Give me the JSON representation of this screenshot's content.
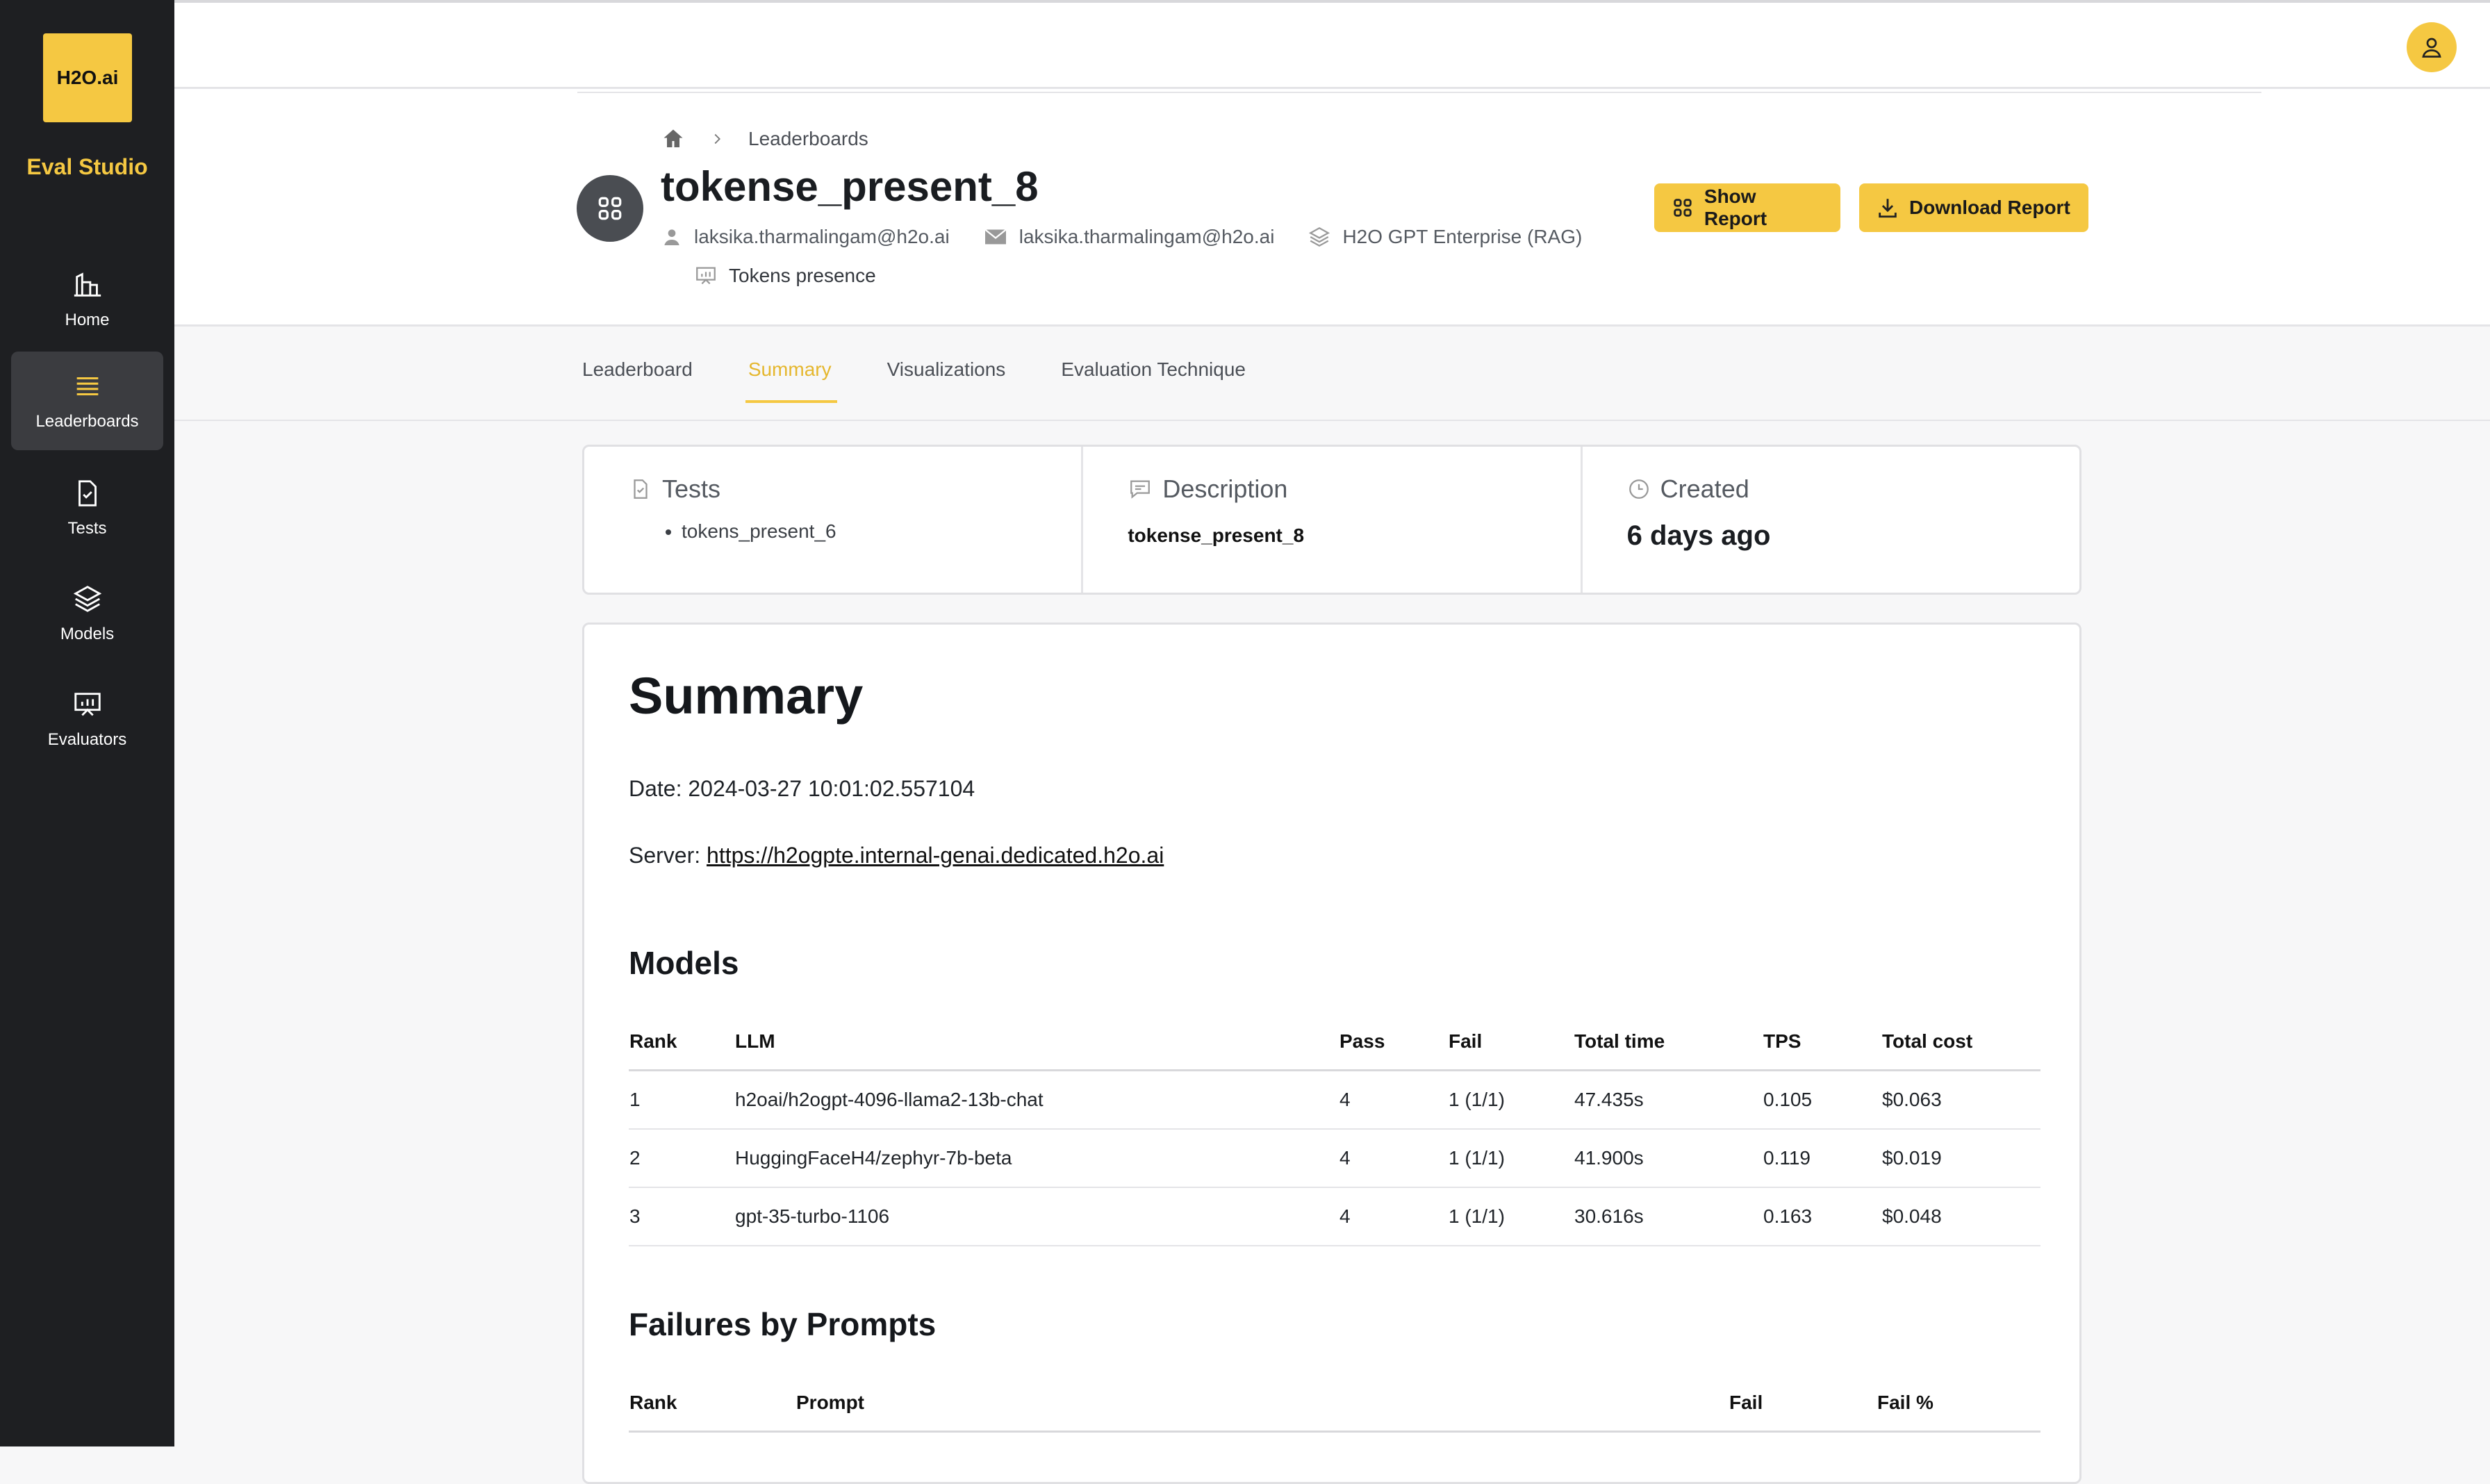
{
  "sidebar": {
    "logo_text": "H2O.ai",
    "app_name": "Eval Studio",
    "items": [
      {
        "label": "Home"
      },
      {
        "label": "Leaderboards"
      },
      {
        "label": "Tests"
      },
      {
        "label": "Models"
      },
      {
        "label": "Evaluators"
      }
    ]
  },
  "breadcrumb": {
    "current": "Leaderboards"
  },
  "header": {
    "title": "tokense_present_8",
    "owner": "laksika.tharmalingam@h2o.ai",
    "email": "laksika.tharmalingam@h2o.ai",
    "model_type": "H2O GPT Enterprise (RAG)",
    "evaluator": "Tokens presence",
    "show_report": "Show Report",
    "download_report": "Download Report"
  },
  "tabs": [
    {
      "label": "Leaderboard"
    },
    {
      "label": "Summary"
    },
    {
      "label": "Visualizations"
    },
    {
      "label": "Evaluation Technique"
    }
  ],
  "info": {
    "tests_title": "Tests",
    "tests_items": [
      "tokens_present_6"
    ],
    "description_title": "Description",
    "description": "tokense_present_8",
    "created_title": "Created",
    "created": "6 days ago"
  },
  "summary": {
    "title": "Summary",
    "date_label": "Date: 2024-03-27 10:01:02.557104",
    "server_label": "Server: ",
    "server_url": "https://h2ogpte.internal-genai.dedicated.h2o.ai",
    "models_title": "Models",
    "models_headers": [
      "Rank",
      "LLM",
      "Pass",
      "Fail",
      "Total time",
      "TPS",
      "Total cost"
    ],
    "models_rows": [
      [
        "1",
        "h2oai/h2ogpt-4096-llama2-13b-chat",
        "4",
        "1 (1/1)",
        "47.435s",
        "0.105",
        "$0.063"
      ],
      [
        "2",
        "HuggingFaceH4/zephyr-7b-beta",
        "4",
        "1 (1/1)",
        "41.900s",
        "0.119",
        "$0.019"
      ],
      [
        "3",
        "gpt-35-turbo-1106",
        "4",
        "1 (1/1)",
        "30.616s",
        "0.163",
        "$0.048"
      ]
    ],
    "failures_title": "Failures by Prompts",
    "failures_headers": [
      "Rank",
      "Prompt",
      "Fail",
      "Fail %"
    ]
  },
  "colors": {
    "accent": "#f5c842",
    "sidebar": "#1e1f22"
  },
  "icons": [
    "home-icon",
    "leaderboards-icon",
    "tests-icon",
    "models-icon",
    "evaluators-icon",
    "user-icon"
  ]
}
